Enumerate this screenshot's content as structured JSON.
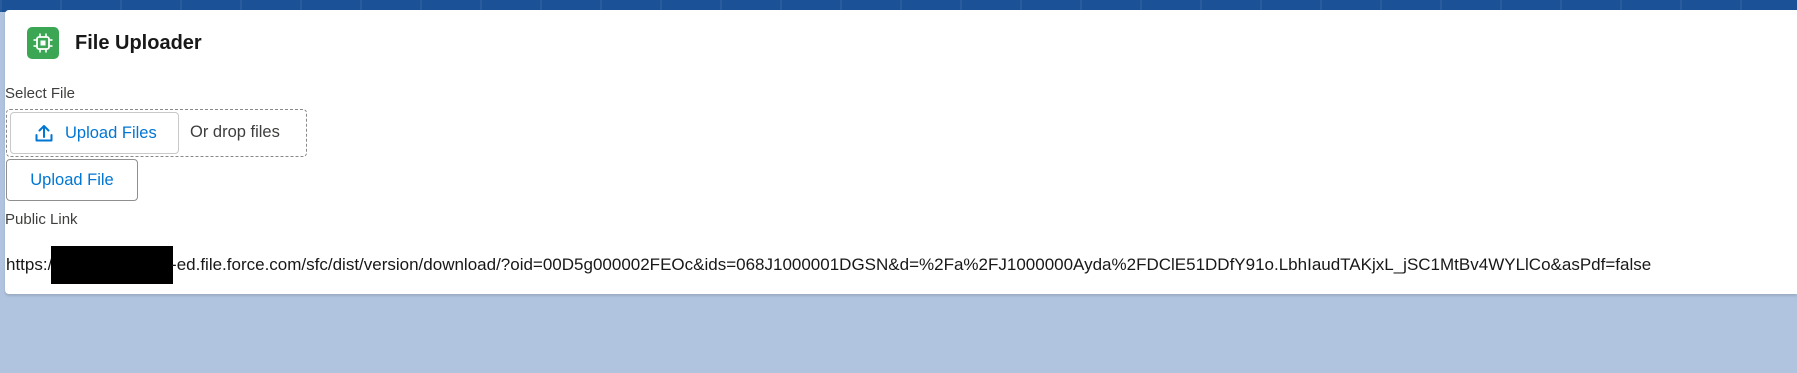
{
  "card": {
    "title": "File Uploader",
    "icon": "chip-icon"
  },
  "select_file": {
    "label": "Select File",
    "upload_files_label": "Upload Files",
    "drop_text": "Or drop files"
  },
  "upload_button": {
    "label": "Upload File"
  },
  "public_link": {
    "label": "Public Link",
    "prefix": "https://",
    "suffix": "-ed.file.force.com/sfc/dist/version/download/?oid=00D5g000002FEOc&ids=068J1000001DGSN&d=%2Fa%2FJ1000000Ayda%2FDClE51DDfY91o.LbhIaudTAKjxL_jSC1MtBv4WYLlCo&asPdf=false"
  },
  "colors": {
    "accent": "#0176d3",
    "app_icon": "#3ba755",
    "page_background": "#b0c4df",
    "top_band": "#1b5297"
  }
}
